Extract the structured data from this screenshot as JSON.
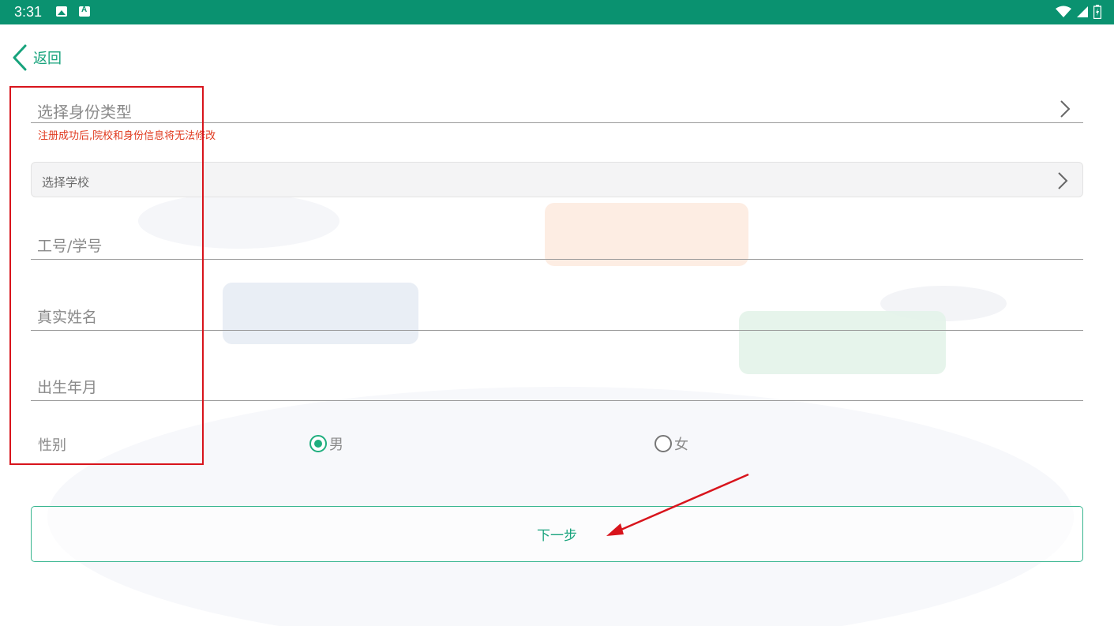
{
  "status_bar": {
    "time": "3:31",
    "icons": [
      "image-icon",
      "a-icon",
      "wifi-icon",
      "signal-icon",
      "battery-icon"
    ],
    "background": "#0a9270"
  },
  "header": {
    "back_label": "返回"
  },
  "form": {
    "identity_placeholder": "选择身份类型",
    "warning": "注册成功后,院校和身份信息将无法修改",
    "school_placeholder": "选择学校",
    "job_no_placeholder": "工号/学号",
    "real_name_placeholder": "真实姓名",
    "birth_placeholder": "出生年月",
    "gender_label": "性别",
    "gender_options": [
      {
        "label": "男",
        "selected": true
      },
      {
        "label": "女",
        "selected": false
      }
    ]
  },
  "next_button": {
    "label": "下一步"
  },
  "colors": {
    "accent": "#17a37c",
    "warning": "#e03a1f",
    "annotation": "#d8141c"
  }
}
